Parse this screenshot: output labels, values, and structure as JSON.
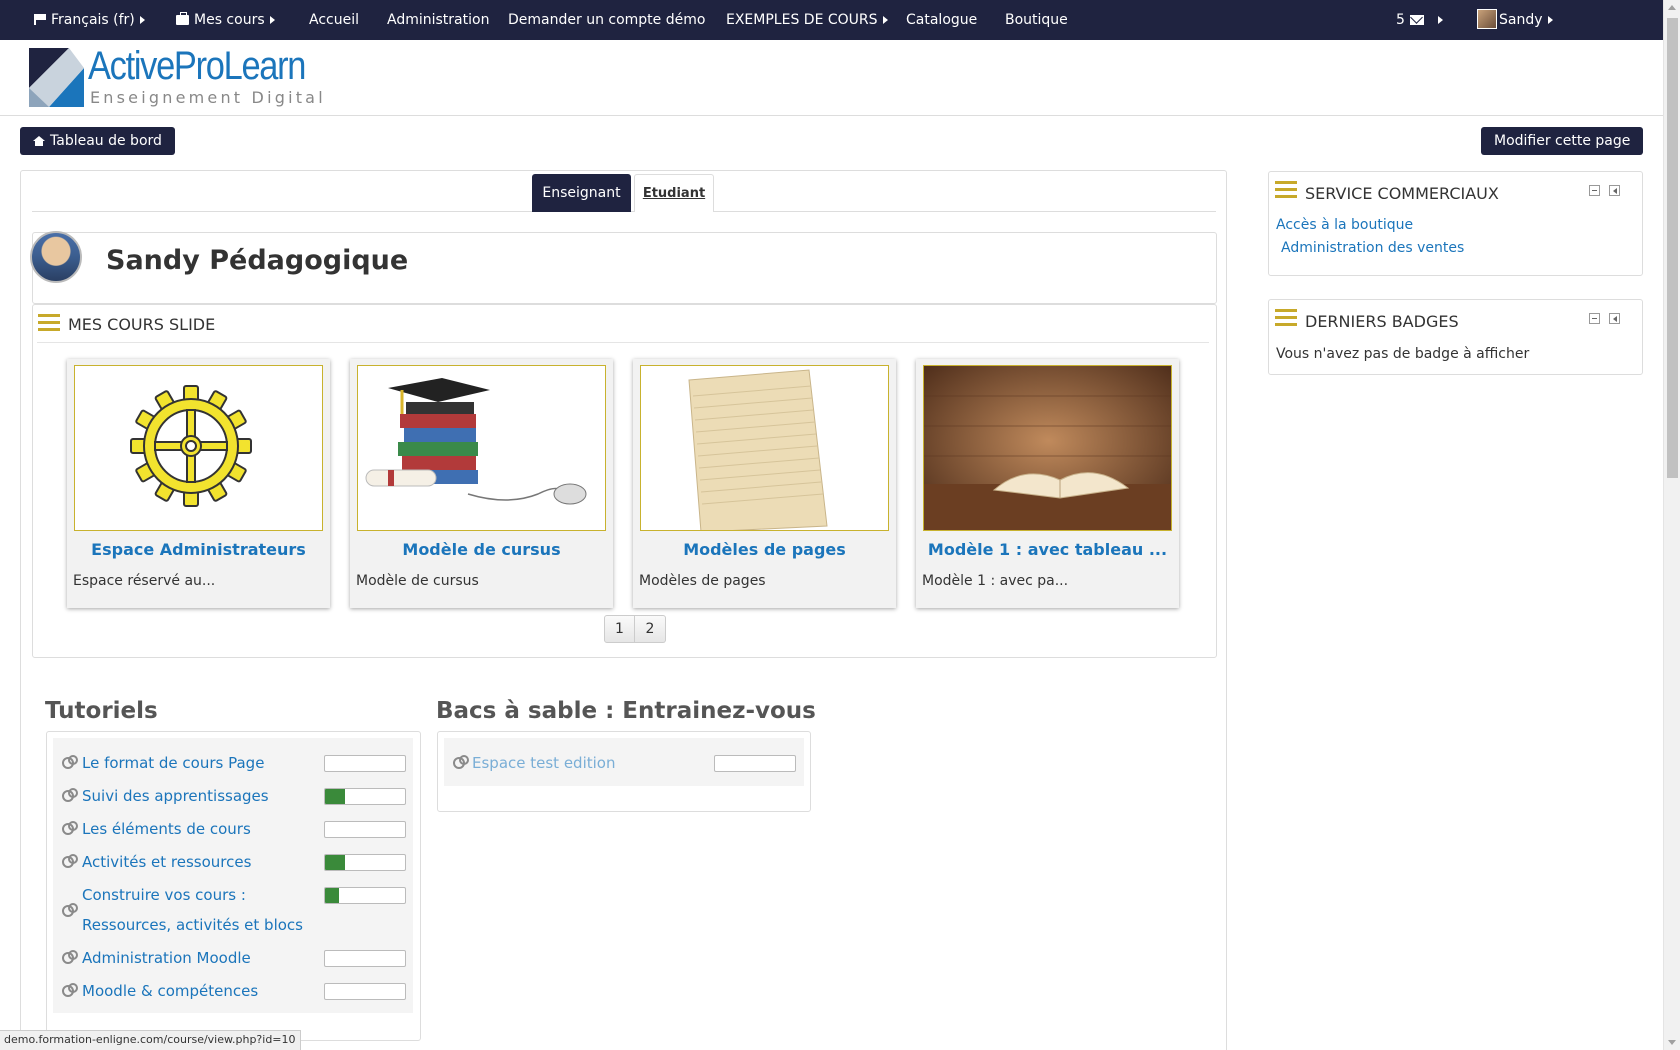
{
  "topnav": {
    "language": "Français (fr)",
    "my_courses": "Mes cours",
    "links": [
      "Accueil",
      "Administration",
      "Demander un compte démo",
      "EXEMPLES DE COURS",
      "Catalogue",
      "Boutique"
    ],
    "message_count": "5",
    "user_name": "Sandy"
  },
  "logo": {
    "title": "ActiveProLearn",
    "subtitle": "Enseignement Digital"
  },
  "buttons": {
    "dashboard": "Tableau de bord",
    "edit_page": "Modifier cette page"
  },
  "tabs": {
    "active": "Enseignant",
    "other": "Etudiant"
  },
  "profile": {
    "name": "Sandy Pédagogique"
  },
  "slide_block": {
    "title": "MES COURS SLIDE",
    "cards": [
      {
        "title": "Espace Administrateurs",
        "desc": "Espace réservé au...",
        "image": "gear-image"
      },
      {
        "title": "Modèle de cursus",
        "desc": "Modèle de cursus",
        "image": "books-graduation-image"
      },
      {
        "title": "Modèles de pages",
        "desc": "Modèles de pages",
        "image": "paper-image"
      },
      {
        "title": "Modèle 1 : avec tableau ...",
        "desc": "Modèle 1 : avec pa...",
        "image": "open-book-image"
      }
    ],
    "pages": [
      "1",
      "2"
    ]
  },
  "tutoriels": {
    "title": "Tutoriels",
    "items": [
      {
        "label": "Le format de cours Page",
        "progress": 0
      },
      {
        "label": "Suivi des apprentissages",
        "progress": 0.25
      },
      {
        "label": "Les éléments de cours",
        "progress": 0
      },
      {
        "label": "Activités et ressources",
        "progress": 0.25
      },
      {
        "label_line1": "Construire vos cours :",
        "label_line2": "Ressources, activités et blocs",
        "progress": 0.17
      },
      {
        "label": "Administration Moodle",
        "progress": 0
      },
      {
        "label": "Moodle & compétences",
        "progress": 0
      }
    ]
  },
  "sandbox": {
    "title": "Bacs à sable : Entrainez-vous",
    "items": [
      {
        "label": "Espace test edition",
        "progress": 0
      }
    ]
  },
  "side": {
    "commercial": {
      "title": "SERVICE COMMERCIAUX",
      "links": [
        "Accès à la boutique",
        "Administration des ventes"
      ]
    },
    "badges": {
      "title": "DERNIERS BADGES",
      "text": "Vous n'avez pas de badge à afficher"
    }
  },
  "status_url": "demo.formation-enligne.com/course/view.php?id=10",
  "colors": {
    "nav": "#1f2340",
    "link": "#1b75bb",
    "accent": "#c7a92a",
    "progress": "#3a8a3a"
  }
}
